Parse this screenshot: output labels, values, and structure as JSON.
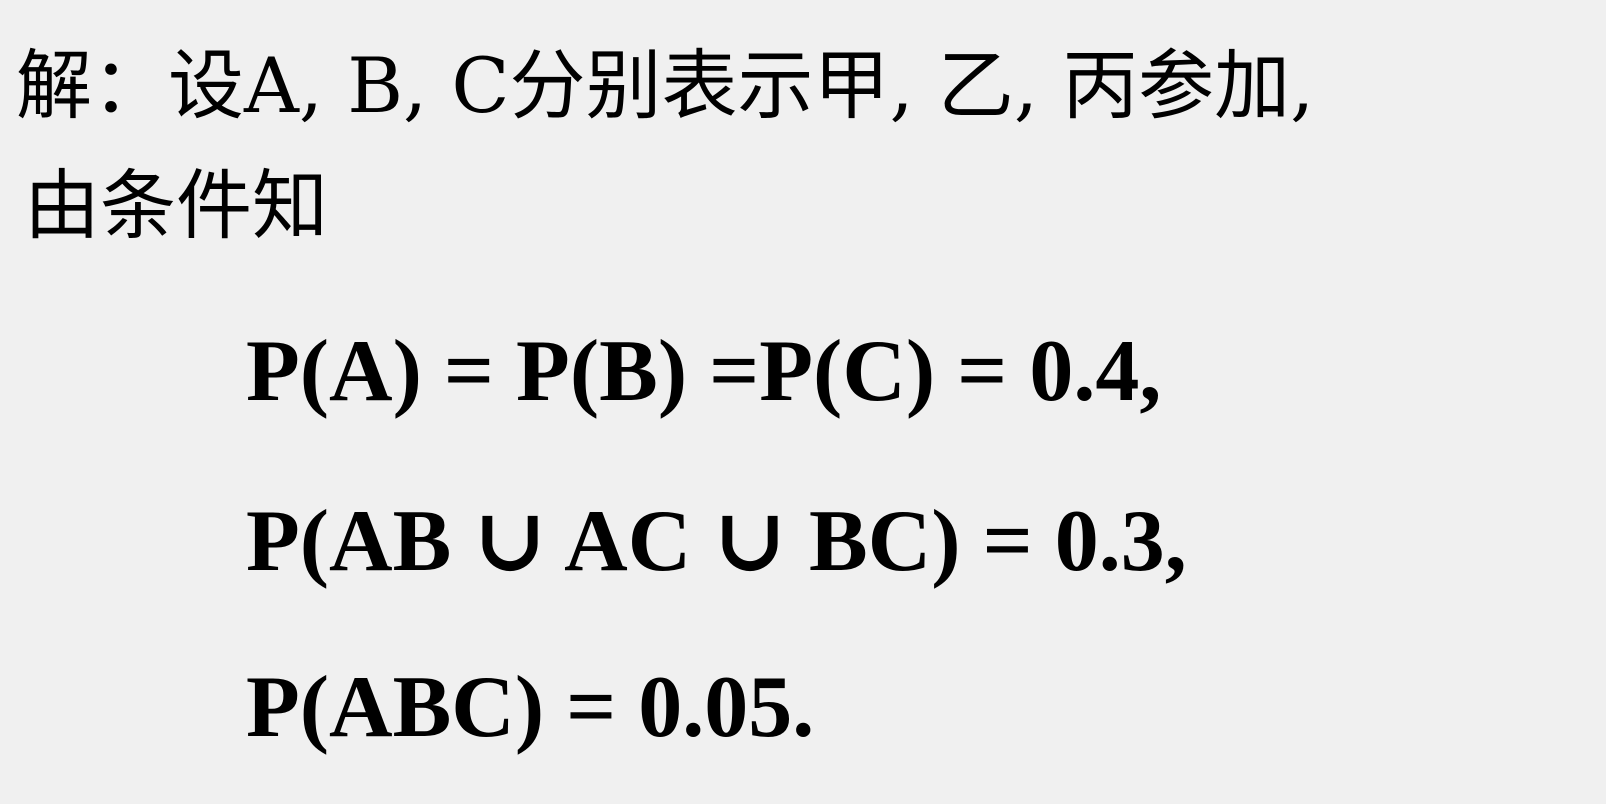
{
  "solution": {
    "intro_line_1": "解：设A, B, C分别表示甲, 乙, 丙参加,",
    "intro_line_2": "由条件知",
    "formula_1": "P(A) = P(B) =P(C) = 0.4,",
    "formula_2": "P(AB ∪ AC ∪ BC) = 0.3,",
    "formula_3": "P(ABC) = 0.05."
  },
  "colors": {
    "background": "#f0f0f0",
    "text": "#000000"
  }
}
